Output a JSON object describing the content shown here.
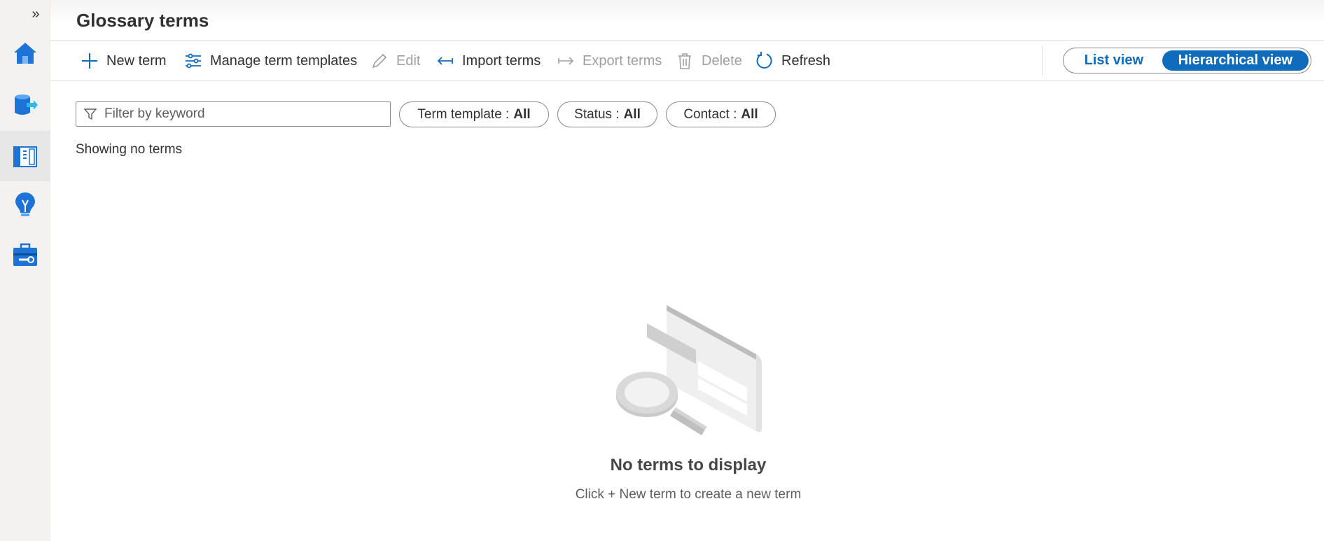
{
  "header": {
    "title": "Glossary terms"
  },
  "rail": {
    "expand_glyph": "»",
    "items": [
      {
        "icon": "home-icon",
        "active": false
      },
      {
        "icon": "data-map-icon",
        "active": false
      },
      {
        "icon": "data-catalog-icon",
        "active": true
      },
      {
        "icon": "insights-icon",
        "active": false
      },
      {
        "icon": "management-icon",
        "active": false
      }
    ]
  },
  "toolbar": {
    "new_term": "New term",
    "manage_templates": "Manage term templates",
    "edit": "Edit",
    "import": "Import terms",
    "export": "Export terms",
    "delete": "Delete",
    "refresh": "Refresh"
  },
  "view_toggle": {
    "list": "List view",
    "hierarchical": "Hierarchical view",
    "selected": "Hierarchical view"
  },
  "filters": {
    "keyword_placeholder": "Filter by keyword",
    "term_template_label": "Term template :",
    "term_template_value": "All",
    "status_label": "Status :",
    "status_value": "All",
    "contact_label": "Contact :",
    "contact_value": "All"
  },
  "results": {
    "summary": "Showing no terms"
  },
  "empty_state": {
    "title": "No terms to display",
    "subtitle": "Click + New term to create a new term"
  },
  "colors": {
    "accent": "#0f6cbd",
    "disabled": "#a19f9d",
    "rail_bg": "#f3f2f1"
  }
}
